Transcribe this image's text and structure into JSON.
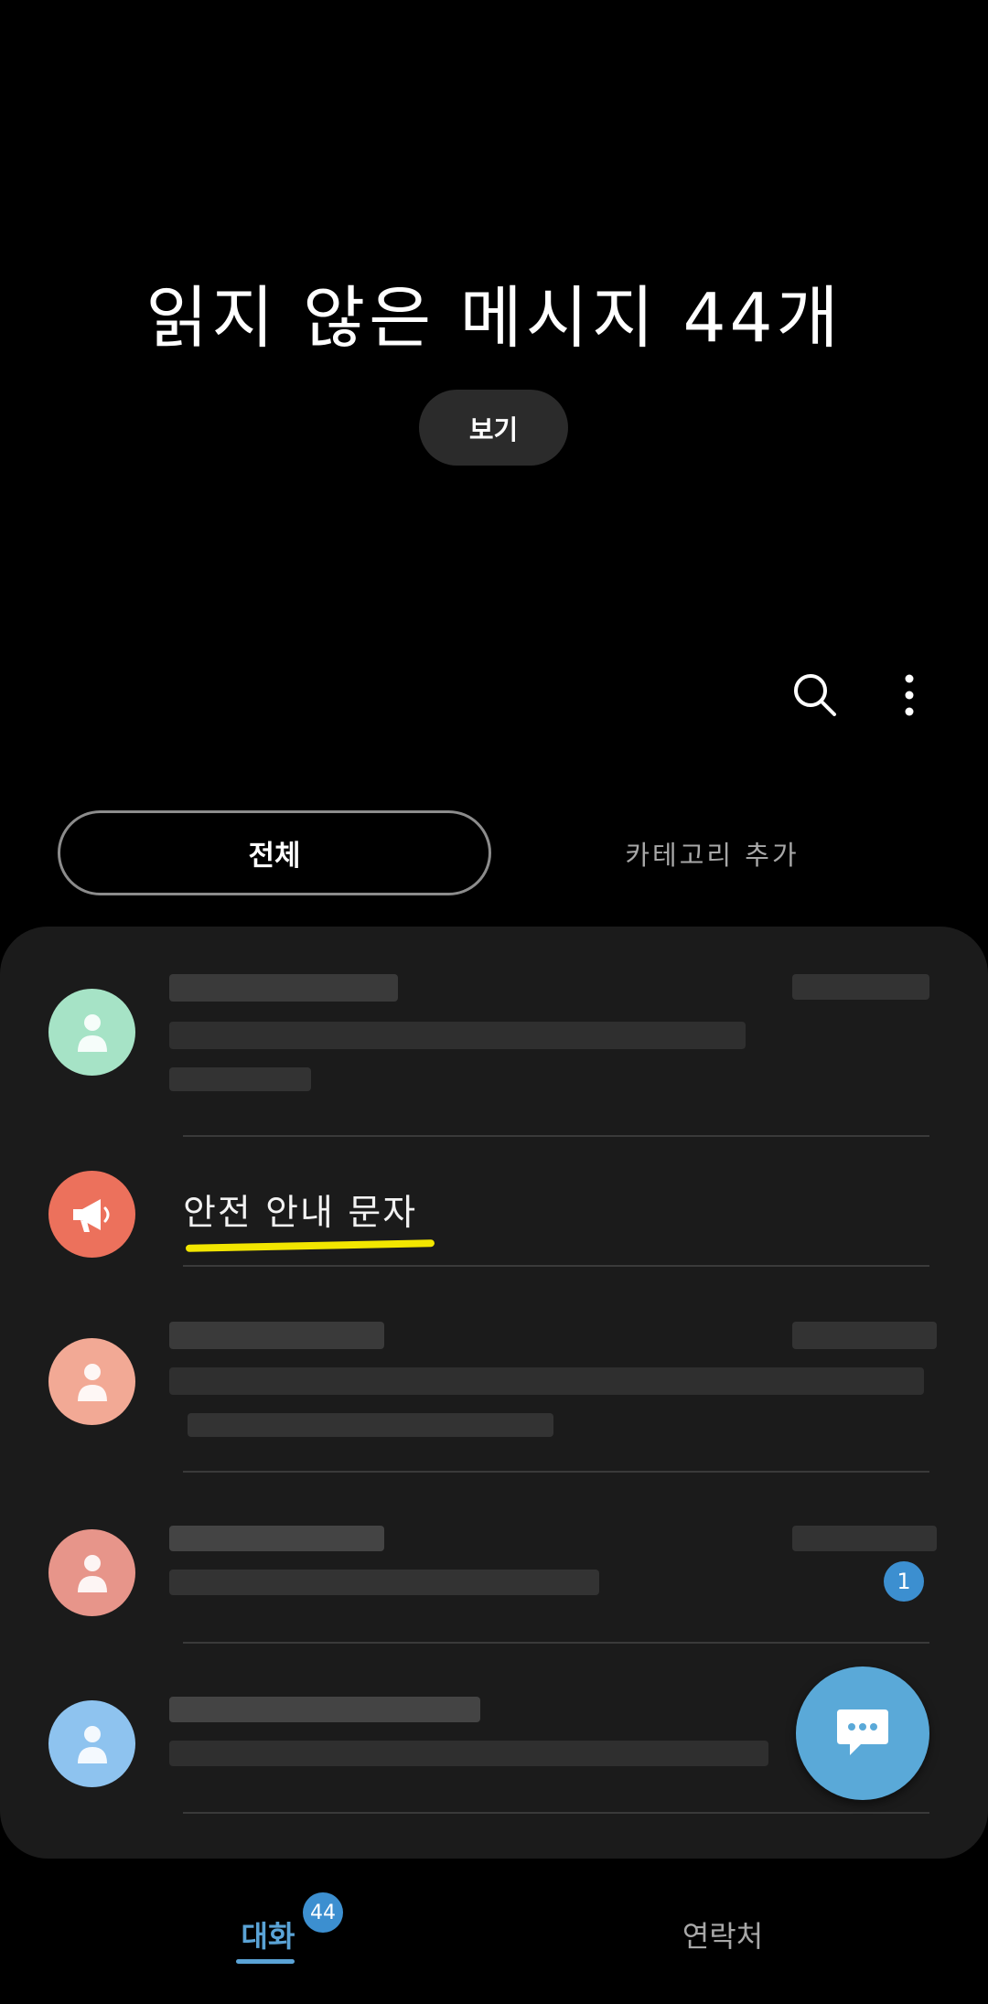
{
  "header": {
    "headline": "읽지 않은 메시지 44개",
    "view_button": "보기"
  },
  "toolbar": {
    "search_icon": "search-icon",
    "more_icon": "more-vertical-icon"
  },
  "tabs": {
    "all": "전체",
    "add_category": "카테고리 추가"
  },
  "conversations": [
    {
      "avatar_color": "#a6e3c6",
      "icon": "person-icon",
      "blurred": true
    },
    {
      "avatar_color": "#ec715c",
      "icon": "megaphone-icon",
      "name": "안전 안내 문자"
    },
    {
      "avatar_color": "#f2a995",
      "icon": "person-icon",
      "blurred": true
    },
    {
      "avatar_color": "#e7958a",
      "icon": "person-icon",
      "blurred": true,
      "unread": "1"
    },
    {
      "avatar_color": "#8ec3ef",
      "icon": "person-icon",
      "blurred": true
    }
  ],
  "fab": {
    "icon": "chat-bubble-icon"
  },
  "bottom_nav": {
    "chats": "대화",
    "chats_badge": "44",
    "contacts": "연락처"
  },
  "colors": {
    "accent": "#5aa3d6",
    "badge": "#3c8fd0",
    "panel": "#1b1b1b",
    "highlight": "#f2e600"
  }
}
